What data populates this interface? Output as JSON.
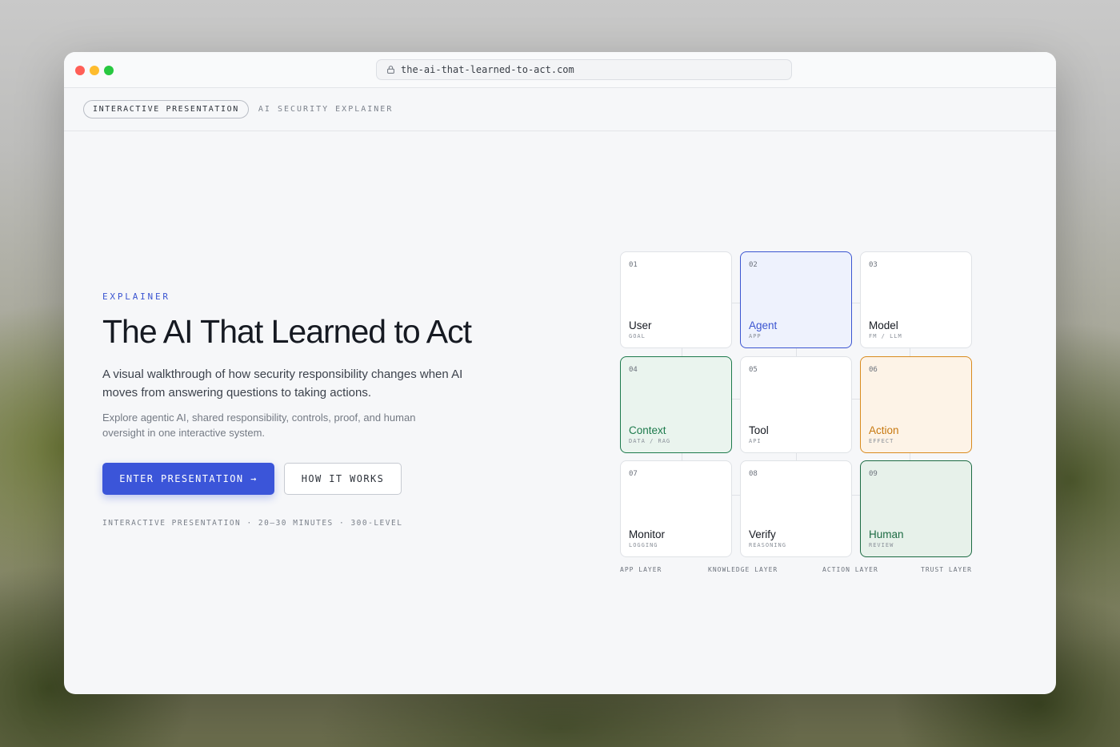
{
  "browser": {
    "url": "the-ai-that-learned-to-act.com"
  },
  "appbar": {
    "pill": "INTERACTIVE PRESENTATION",
    "subtitle": "AI SECURITY EXPLAINER"
  },
  "hero": {
    "eyebrow": "EXPLAINER",
    "title": "The AI That Learned to Act",
    "lead": "A visual walkthrough of how security responsibility changes when AI moves from answering questions to taking actions.",
    "sub": "Explore agentic AI, shared responsibility, controls, proof, and human oversight in one interactive system.",
    "primary_button": "ENTER PRESENTATION →",
    "secondary_button": "HOW IT WORKS",
    "meta": "INTERACTIVE PRESENTATION · 20–30 MINUTES · 300-LEVEL"
  },
  "grid": {
    "cells": [
      {
        "num": "01",
        "name": "User",
        "tag": "GOAL",
        "variant": "plain"
      },
      {
        "num": "02",
        "name": "Agent",
        "tag": "APP",
        "variant": "blue"
      },
      {
        "num": "03",
        "name": "Model",
        "tag": "FM / LLM",
        "variant": "plain"
      },
      {
        "num": "04",
        "name": "Context",
        "tag": "DATA / RAG",
        "variant": "green"
      },
      {
        "num": "05",
        "name": "Tool",
        "tag": "API",
        "variant": "plain"
      },
      {
        "num": "06",
        "name": "Action",
        "tag": "EFFECT",
        "variant": "orange"
      },
      {
        "num": "07",
        "name": "Monitor",
        "tag": "LOGGING",
        "variant": "plain"
      },
      {
        "num": "08",
        "name": "Verify",
        "tag": "REASONING",
        "variant": "plain"
      },
      {
        "num": "09",
        "name": "Human",
        "tag": "REVIEW",
        "variant": "darkgreen"
      }
    ],
    "layers": [
      "APP LAYER",
      "KNOWLEDGE LAYER",
      "ACTION LAYER",
      "TRUST LAYER"
    ]
  },
  "colors": {
    "accent": "#3b55d1",
    "green": "#1d7a4c",
    "orange": "#d98b1e"
  }
}
